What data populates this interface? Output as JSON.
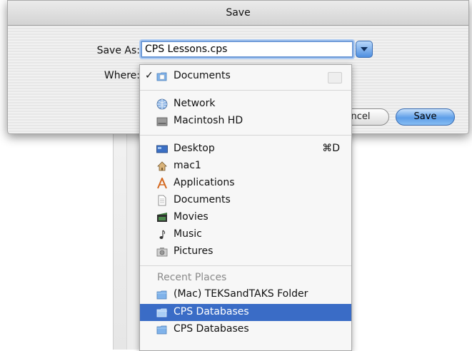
{
  "dialog": {
    "title": "Save",
    "save_as_label": "Save As:",
    "filename": "CPS Lessons.cps",
    "where_label": "Where:",
    "cancel_label": "ncel",
    "save_label": "Save"
  },
  "where_menu": {
    "current": "Documents",
    "check": "✓",
    "volumes": [
      {
        "label": "Network",
        "icon": "network-icon"
      },
      {
        "label": "Macintosh HD",
        "icon": "hard-drive-icon"
      }
    ],
    "places": [
      {
        "label": "Desktop",
        "icon": "desktop-icon",
        "shortcut": "⌘D"
      },
      {
        "label": "mac1",
        "icon": "home-icon"
      },
      {
        "label": "Applications",
        "icon": "applications-icon"
      },
      {
        "label": "Documents",
        "icon": "documents-icon"
      },
      {
        "label": "Movies",
        "icon": "movies-icon"
      },
      {
        "label": "Music",
        "icon": "music-icon"
      },
      {
        "label": "Pictures",
        "icon": "pictures-icon"
      }
    ],
    "recent_header": "Recent Places",
    "recent": [
      {
        "label": "(Mac) TEKSandTAKS Folder",
        "icon": "folder-icon"
      },
      {
        "label": "CPS Databases",
        "icon": "folder-icon",
        "selected": true
      },
      {
        "label": "CPS Databases",
        "icon": "folder-icon"
      }
    ]
  },
  "colors": {
    "selection": "#3a6cc6",
    "accent_blue": "#5d9ee8",
    "folder_blue": "#7fb2ea"
  }
}
